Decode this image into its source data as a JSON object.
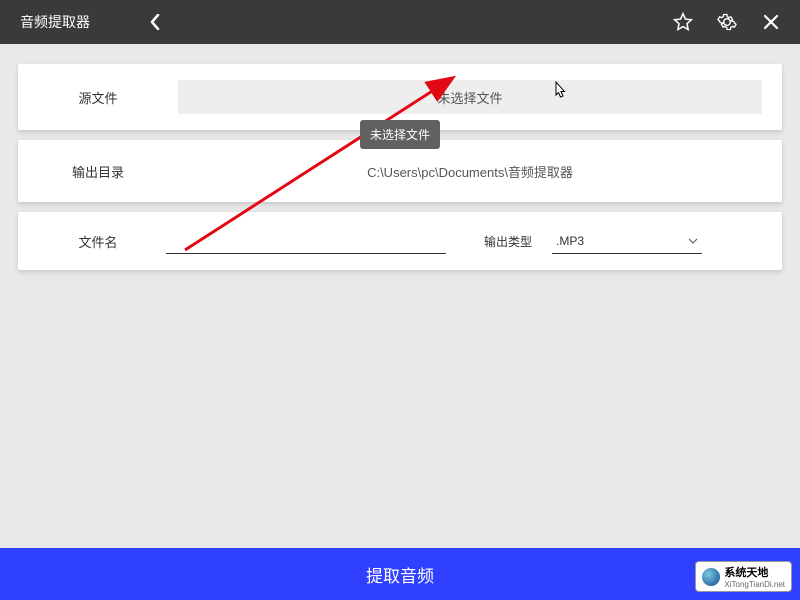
{
  "titlebar": {
    "title": "音频提取器"
  },
  "source": {
    "label": "源文件",
    "placeholder": "未选择文件"
  },
  "tooltip": {
    "text": "未选择文件"
  },
  "output": {
    "label": "输出目录",
    "path": "C:\\Users\\pc\\Documents\\音频提取器"
  },
  "filename": {
    "label": "文件名",
    "value": ""
  },
  "outputType": {
    "label": "输出类型",
    "selected": ".MP3"
  },
  "actions": {
    "extract": "提取音频"
  },
  "watermark": {
    "main": "系统天地",
    "sub": "XiTongTianDi.net"
  }
}
